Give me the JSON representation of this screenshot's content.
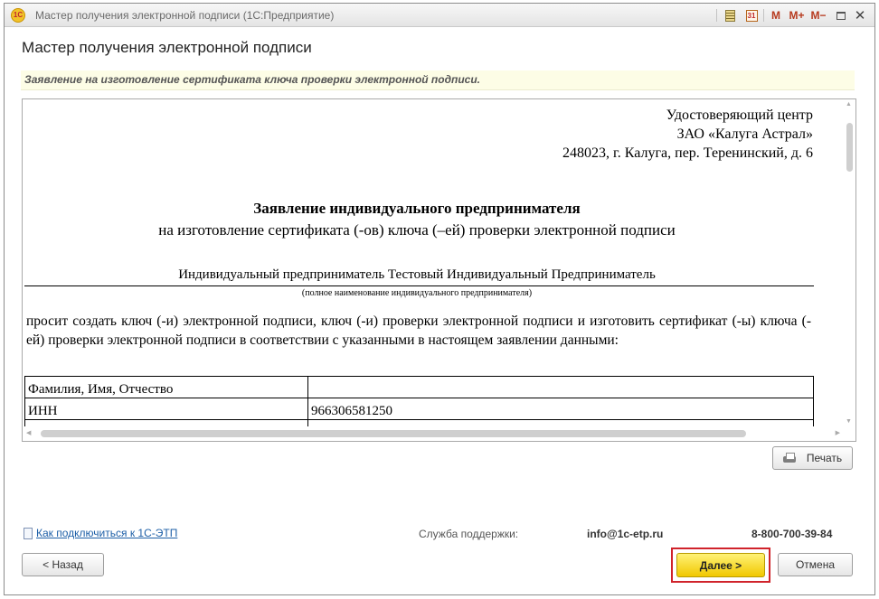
{
  "window": {
    "title": "Мастер получения электронной подписи  (1С:Предприятие)",
    "app_icon": "1c-logo-icon",
    "toolbar": {
      "memory_label": "M",
      "memory_plus_label": "M+",
      "memory_minus_label": "M−",
      "calendar_label": "31",
      "close_glyph": "✕"
    }
  },
  "form": {
    "title": "Мастер получения электронной подписи",
    "subtitle": "Заявление на изготовление сертификата ключа проверки электронной подписи."
  },
  "document": {
    "recipient": [
      "Удостоверяющий центр",
      "ЗАО «Калуга Астрал»",
      "248023, г. Калуга, пер. Теренинский, д. 6"
    ],
    "heading": "Заявление индивидуального предпринимателя",
    "subheading": "на изготовление сертификата (-ов) ключа (–ей) проверки электронной подписи",
    "applicant": "Индивидуальный предприниматель Тестовый Индивидуальный Предприниматель",
    "applicant_caption": "(полное наименование индивидуального предпринимателя)",
    "request_text": "просит создать ключ (-и) электронной подписи, ключ (-и) проверки электронной подписи и изготовить сертификат (-ы) ключа (-ей) проверки электронной подписи в соответствии с указанными в настоящем заявлении данными:",
    "table": [
      {
        "label": "Фамилия, Имя, Отчество",
        "value": ""
      },
      {
        "label": "ИНН",
        "value": "966306581250"
      }
    ]
  },
  "buttons": {
    "print": "Печать",
    "back": "< Назад",
    "next": "Далее >",
    "cancel": "Отмена"
  },
  "footer": {
    "help_link": "Как подключиться к 1С-ЭТП",
    "support_label": "Служба поддержки:",
    "support_email": "info@1c-etp.ru",
    "support_phone": "8-800-700-39-84"
  },
  "colors": {
    "accent_button": "#f1c800",
    "highlight_border": "#d0232b",
    "link": "#1d5fa7",
    "subtitle_bg": "#fdfde6"
  }
}
